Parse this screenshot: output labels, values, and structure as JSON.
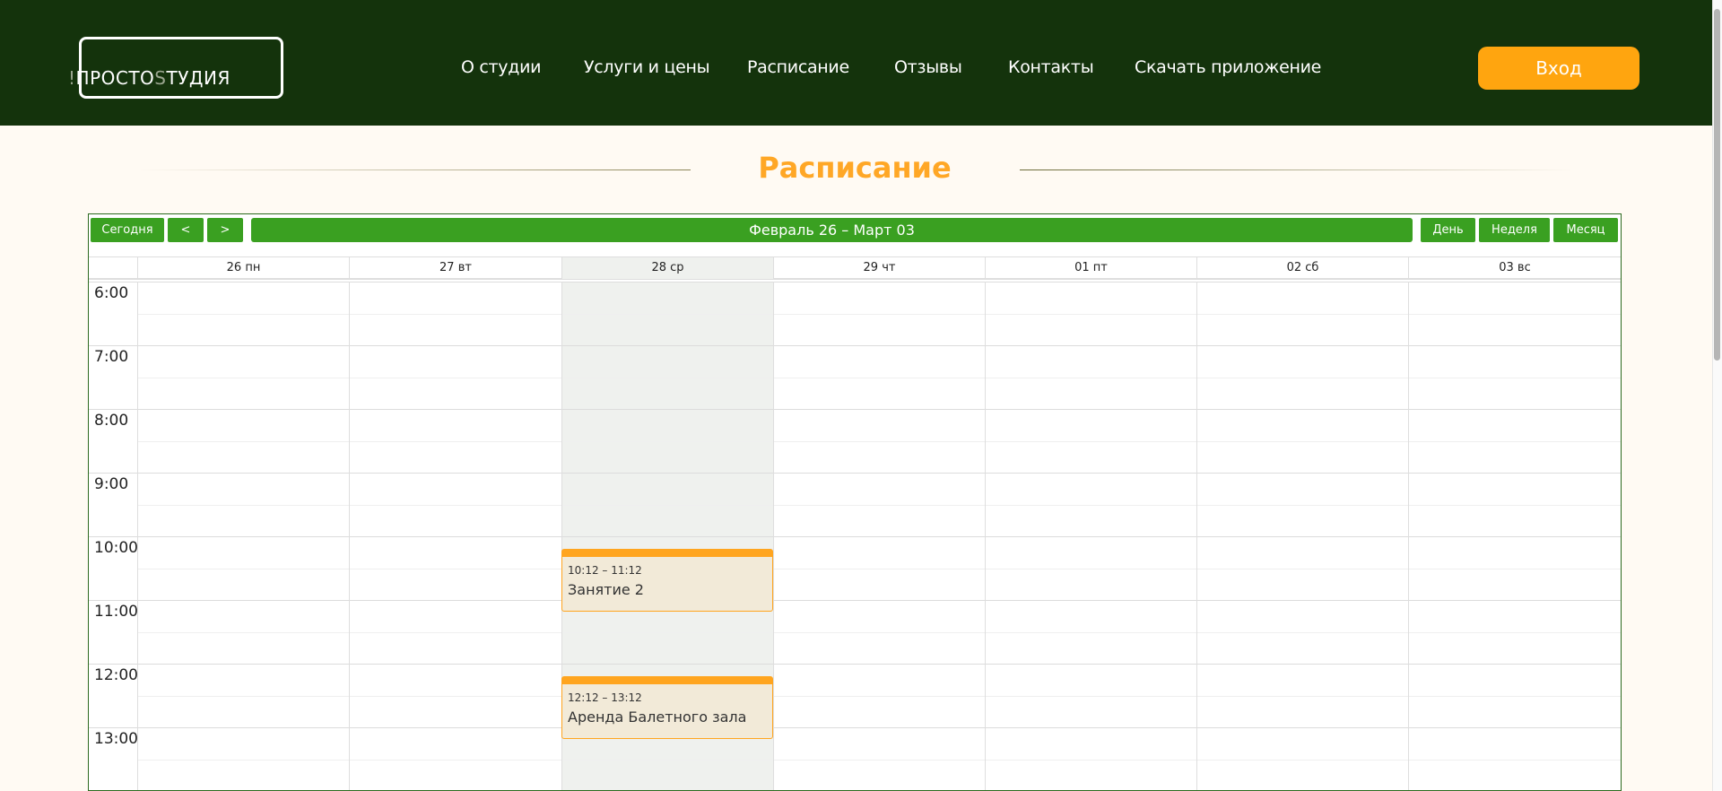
{
  "header": {
    "logo_prefix": "!",
    "logo_main": "ПРОСТО",
    "logo_mid": "S",
    "logo_suffix": "ТУДИЯ",
    "nav": [
      "О студии",
      "Услуги и цены",
      "Расписание",
      "Отзывы",
      "Контакты",
      "Скачать приложение"
    ],
    "login_label": "Вход"
  },
  "page_title": "Расписание",
  "calendar": {
    "toolbar": {
      "today_label": "Сегодня",
      "prev_label": "<",
      "next_label": ">",
      "range_label": "Февраль 26 – Март 03",
      "view_day": "День",
      "view_week": "Неделя",
      "view_month": "Месяц"
    },
    "days": [
      "26 пн",
      "27 вт",
      "28 ср",
      "29 чт",
      "01 пт",
      "02 сб",
      "03 вс"
    ],
    "today_index": 2,
    "hours": [
      "6:00",
      "7:00",
      "8:00",
      "9:00",
      "10:00",
      "11:00",
      "12:00",
      "13:00"
    ],
    "events": [
      {
        "day_index": 2,
        "time": "10:12 – 11:12",
        "title": "Занятие 2"
      },
      {
        "day_index": 2,
        "time": "12:12 – 13:12",
        "title": "Аренда Балетного зала"
      }
    ]
  },
  "colors": {
    "header_bg": "#14330c",
    "accent_orange": "#ffa50f",
    "toolbar_green": "#3aa021"
  }
}
